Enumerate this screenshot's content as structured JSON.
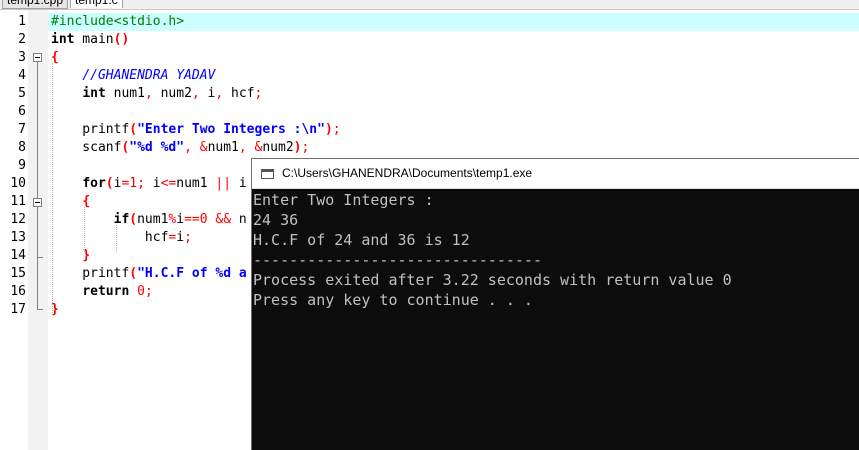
{
  "tabs": [
    {
      "label": "temp1.cpp",
      "active": false
    },
    {
      "label": "temp1.c",
      "active": true
    }
  ],
  "editor": {
    "line_numbers": [
      "1",
      "2",
      "3",
      "4",
      "5",
      "6",
      "7",
      "8",
      "9",
      "10",
      "11",
      "12",
      "13",
      "14",
      "15",
      "16",
      "17"
    ],
    "highlight_color": "#ccffff",
    "lines": [
      [
        {
          "t": "#include<stdio.h>",
          "c": "pp"
        }
      ],
      [
        {
          "t": "int",
          "c": "kw"
        },
        {
          "t": " main"
        },
        {
          "t": "()",
          "c": "br"
        }
      ],
      [
        {
          "t": "{",
          "c": "br"
        }
      ],
      [
        {
          "t": "    "
        },
        {
          "t": "//GHANENDRA YADAV",
          "c": "cm"
        }
      ],
      [
        {
          "t": "    "
        },
        {
          "t": "int",
          "c": "kw"
        },
        {
          "t": " num1"
        },
        {
          "t": ",",
          "c": "op"
        },
        {
          "t": " num2"
        },
        {
          "t": ",",
          "c": "op"
        },
        {
          "t": " i"
        },
        {
          "t": ",",
          "c": "op"
        },
        {
          "t": " hcf"
        },
        {
          "t": ";",
          "c": "op"
        }
      ],
      [],
      [
        {
          "t": "    printf"
        },
        {
          "t": "(",
          "c": "br"
        },
        {
          "t": "\"Enter Two Integers :\\n\"",
          "c": "st"
        },
        {
          "t": ")",
          "c": "br"
        },
        {
          "t": ";",
          "c": "op"
        }
      ],
      [
        {
          "t": "    scanf"
        },
        {
          "t": "(",
          "c": "br"
        },
        {
          "t": "\"%d %d\"",
          "c": "st"
        },
        {
          "t": ",",
          "c": "op"
        },
        {
          "t": " "
        },
        {
          "t": "&",
          "c": "op"
        },
        {
          "t": "num1"
        },
        {
          "t": ",",
          "c": "op"
        },
        {
          "t": " "
        },
        {
          "t": "&",
          "c": "op"
        },
        {
          "t": "num2"
        },
        {
          "t": ")",
          "c": "br"
        },
        {
          "t": ";",
          "c": "op"
        }
      ],
      [],
      [
        {
          "t": "    "
        },
        {
          "t": "for",
          "c": "kw"
        },
        {
          "t": "(",
          "c": "br"
        },
        {
          "t": "i"
        },
        {
          "t": "=",
          "c": "op"
        },
        {
          "t": "1",
          "c": "nm"
        },
        {
          "t": ";",
          "c": "op"
        },
        {
          "t": " i"
        },
        {
          "t": "<=",
          "c": "op"
        },
        {
          "t": "num1 "
        },
        {
          "t": "||",
          "c": "op"
        },
        {
          "t": " i"
        }
      ],
      [
        {
          "t": "    "
        },
        {
          "t": "{",
          "c": "br"
        }
      ],
      [
        {
          "t": "        "
        },
        {
          "t": "if",
          "c": "kw"
        },
        {
          "t": "(",
          "c": "br"
        },
        {
          "t": "num1"
        },
        {
          "t": "%",
          "c": "op"
        },
        {
          "t": "i"
        },
        {
          "t": "==",
          "c": "op"
        },
        {
          "t": "0",
          "c": "nm"
        },
        {
          "t": " "
        },
        {
          "t": "&&",
          "c": "op"
        },
        {
          "t": " n"
        }
      ],
      [
        {
          "t": "            hcf"
        },
        {
          "t": "=",
          "c": "op"
        },
        {
          "t": "i"
        },
        {
          "t": ";",
          "c": "op"
        }
      ],
      [
        {
          "t": "    "
        },
        {
          "t": "}",
          "c": "br"
        }
      ],
      [
        {
          "t": "    printf"
        },
        {
          "t": "(",
          "c": "br"
        },
        {
          "t": "\"H.C.F of %d a",
          "c": "st"
        }
      ],
      [
        {
          "t": "    "
        },
        {
          "t": "return",
          "c": "kw"
        },
        {
          "t": " "
        },
        {
          "t": "0",
          "c": "nm"
        },
        {
          "t": ";",
          "c": "op"
        }
      ],
      [
        {
          "t": "}",
          "c": "br"
        }
      ]
    ]
  },
  "console": {
    "title": "C:\\Users\\GHANENDRA\\Documents\\temp1.exe",
    "lines": [
      "Enter Two Integers :",
      "24 36",
      "H.C.F of 24 and 36 is 12",
      "--------------------------------",
      "Process exited after 3.22 seconds with return value 0",
      "Press any key to continue . . ."
    ],
    "background": "#0c0c0c",
    "text_color": "#c0c0c0"
  }
}
